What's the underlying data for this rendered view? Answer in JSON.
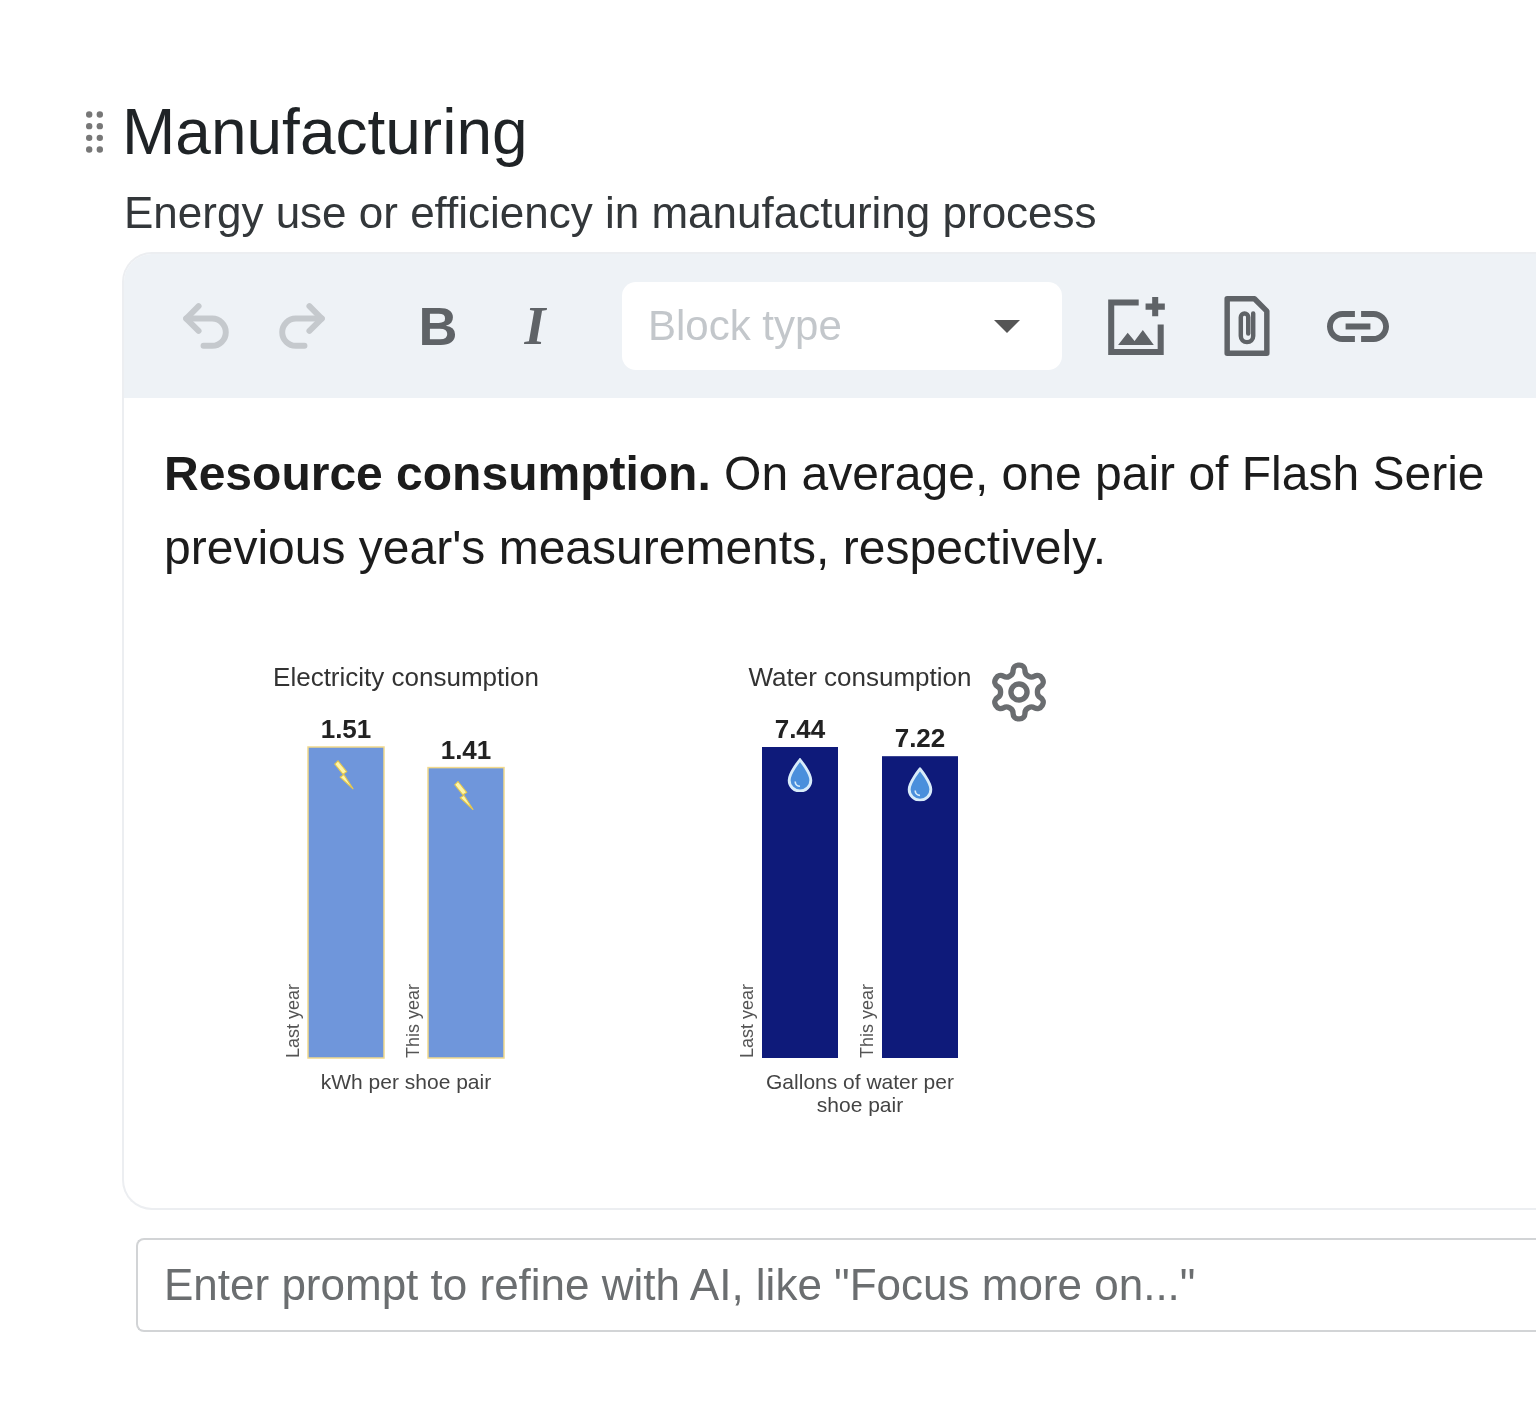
{
  "section": {
    "title": "Manufacturing",
    "subtitle": "Energy use or efficiency in manufacturing process"
  },
  "editor": {
    "toolbar": {
      "history": [
        {
          "kind": "undo",
          "disabled": true
        },
        {
          "kind": "redo",
          "disabled": true
        }
      ],
      "format": [
        {
          "kind": "bold",
          "label": "B",
          "disabled": false
        },
        {
          "kind": "italic",
          "label": "I",
          "disabled": false
        }
      ],
      "block_type": {
        "placeholder": "Block type"
      },
      "insert": [
        {
          "kind": "image",
          "disabled": false
        },
        {
          "kind": "attachment",
          "disabled": false
        },
        {
          "kind": "link",
          "disabled": false
        }
      ]
    },
    "paragraph": {
      "lines": [
        "**Resource consumption.** On average, one pair of Flash Serie",
        "previous year's measurements, respectively."
      ]
    },
    "charts": [
      {
        "kind": "electricity",
        "color": "#6f96db",
        "hovered": false,
        "chart_data": {
          "type": "bar",
          "title": "Electricity consumption",
          "xlabel": "kWh per shoe pair",
          "categories": [
            "Last year",
            "This year"
          ],
          "values": [
            1.51,
            1.41
          ],
          "data_labels": true
        }
      },
      {
        "kind": "water",
        "color": "#0e1a7a",
        "hovered": true,
        "chart_data": {
          "type": "bar",
          "title": "Water consumption",
          "xlabel": "Gallons of water per shoe pair",
          "categories": [
            "Last year",
            "This year"
          ],
          "values": [
            7.44,
            7.22
          ],
          "data_labels": true
        }
      }
    ]
  },
  "prompt": {
    "placeholder": "Enter prompt to refine with AI, like \"Focus more on...\""
  }
}
